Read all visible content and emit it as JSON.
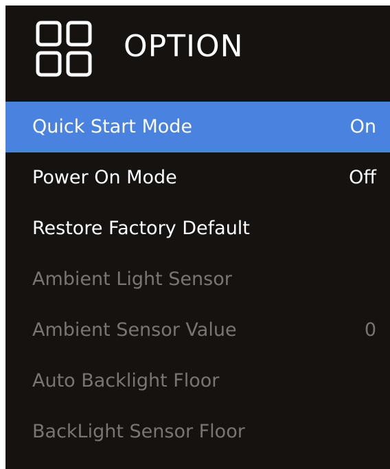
{
  "menu": {
    "title": "OPTION",
    "icon": "grid-icon",
    "items": [
      {
        "label": "Quick Start Mode",
        "value": "On"
      },
      {
        "label": "Power On Mode",
        "value": "Off"
      },
      {
        "label": "Restore Factory Default",
        "value": ""
      },
      {
        "label": "Ambient Light Sensor",
        "value": ""
      },
      {
        "label": "Ambient Sensor Value",
        "value": "0"
      },
      {
        "label": "Auto Backlight Floor",
        "value": ""
      },
      {
        "label": "BackLight Sensor Floor",
        "value": ""
      }
    ],
    "selected_index": 0
  },
  "colors": {
    "background": "#161210",
    "highlight": "#4a82df",
    "text_enabled": "#ffffff",
    "text_disabled": "#7a7572"
  }
}
